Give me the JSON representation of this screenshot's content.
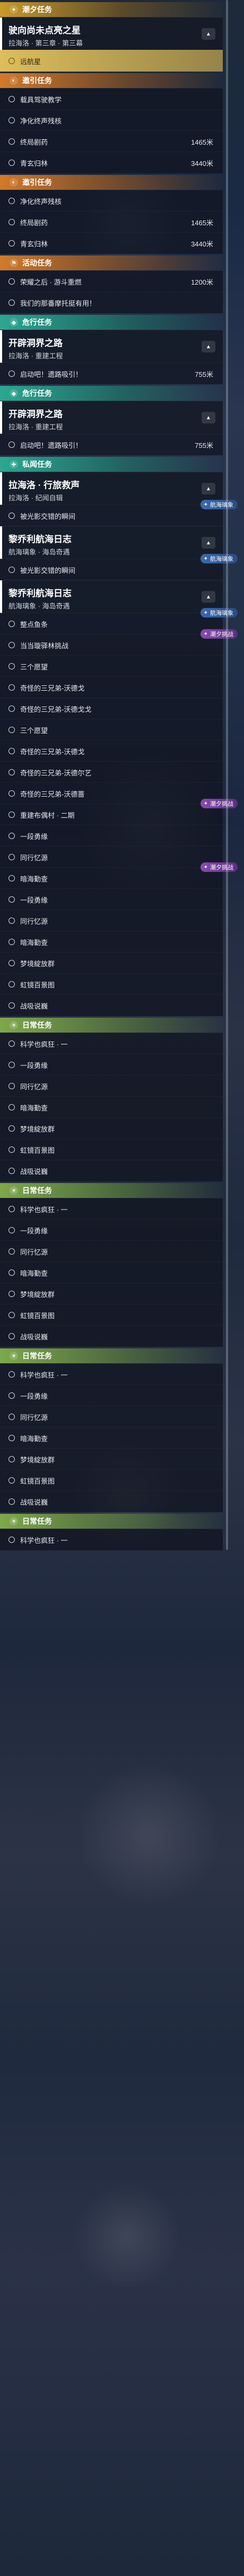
{
  "sections": [
    {
      "type": "cat",
      "color": "yellow",
      "icon": "plus-icon",
      "icon_glyph": "✦",
      "label": "潮夕任务"
    },
    {
      "type": "head",
      "title": "驶向尚未点亮之星",
      "subtitle": "拉海洛 · 第三章 · 第三幕"
    },
    {
      "type": "row",
      "selected": true,
      "text": "远航星"
    },
    {
      "type": "cat",
      "color": "orange",
      "icon": "compass-icon",
      "icon_glyph": "◐",
      "label": "邀引任务"
    },
    {
      "type": "row",
      "text": "载具驾驶教学"
    },
    {
      "type": "row",
      "text": "净化终声残核"
    },
    {
      "type": "row",
      "text": "终局剧药",
      "distance": "1465米"
    },
    {
      "type": "row",
      "text": "青玄归林",
      "distance": "3440米"
    },
    {
      "type": "cat",
      "color": "orange",
      "icon": "compass-icon",
      "icon_glyph": "◐",
      "label": "邀引任务"
    },
    {
      "type": "row",
      "text": "净化终声残核"
    },
    {
      "type": "row",
      "text": "终局剧药",
      "distance": "1465米"
    },
    {
      "type": "row",
      "text": "青玄归林",
      "distance": "3440米"
    },
    {
      "type": "cat",
      "color": "orange",
      "icon": "flag-icon",
      "icon_glyph": "⚑",
      "label": "活动任务"
    },
    {
      "type": "row",
      "text": "荣耀之后 · 游斗重燃",
      "distance": "1200米"
    },
    {
      "type": "row",
      "text": "我们的那番摩托挺有用！"
    },
    {
      "type": "cat",
      "color": "teal",
      "icon": "diamond-icon",
      "icon_glyph": "◆",
      "label": "危行任务"
    },
    {
      "type": "head",
      "title": "开辟洞界之路",
      "subtitle": "拉海洛 · 重建工程"
    },
    {
      "type": "row",
      "text": "启动吧！遗路吸引！",
      "distance": "755米"
    },
    {
      "type": "cat",
      "color": "teal",
      "icon": "diamond-icon",
      "icon_glyph": "◆",
      "label": "危行任务"
    },
    {
      "type": "head",
      "title": "开辟洞界之路",
      "subtitle": "拉海洛 · 重建工程"
    },
    {
      "type": "row",
      "text": "启动吧！遗路吸引！",
      "distance": "755米"
    },
    {
      "type": "cat",
      "color": "teal",
      "icon": "shield-icon",
      "icon_glyph": "✚",
      "label": "私闻任务"
    },
    {
      "type": "head",
      "title": "拉海洛 · 行旅救声",
      "subtitle": "拉海洛 · 纪闻自辑"
    },
    {
      "type": "row",
      "text": "被光影交错的瞬间",
      "badge": "航海璃象",
      "badge_style": "hh"
    },
    {
      "type": "head",
      "title": "黎乔利航海日志",
      "subtitle": "航海璃象 · 海岛奇遇"
    },
    {
      "type": "row",
      "text": "被光影交错的瞬间",
      "badge": "航海璃象",
      "badge_style": "hh"
    },
    {
      "type": "head",
      "title": "黎乔利航海日志",
      "subtitle": "航海璃象 · 海岛奇遇"
    },
    {
      "type": "row",
      "text": "整点鱼条",
      "badge": "航海璃象",
      "badge_style": "hh"
    },
    {
      "type": "row",
      "text": "当当璇驿林挑战",
      "badge": "潮夕挑战",
      "badge_style": "cx"
    },
    {
      "type": "row",
      "text": "三个愿望"
    },
    {
      "type": "row",
      "text": "奇怪的三兄弟-沃德戈"
    },
    {
      "type": "row",
      "text": "奇怪的三兄弟-沃德戈戈"
    },
    {
      "type": "row",
      "text": "三个愿望"
    },
    {
      "type": "row",
      "text": "奇怪的三兄弟-沃德戈"
    },
    {
      "type": "row",
      "text": "奇怪的三兄弟-沃德尔艺"
    },
    {
      "type": "row",
      "text": "奇怪的三兄弟-沃德蔷"
    },
    {
      "type": "row",
      "text": "重建布偶村 · 二期",
      "badge": "潮夕挑战",
      "badge_style": "cx"
    },
    {
      "type": "row",
      "text": "一段勇缘"
    },
    {
      "type": "row",
      "text": "同行忆源"
    },
    {
      "type": "row",
      "text": "暗海勤查",
      "badge": "潮夕挑战",
      "badge_style": "cx"
    },
    {
      "type": "row",
      "text": "一段勇缘"
    },
    {
      "type": "row",
      "text": "同行忆源"
    },
    {
      "type": "row",
      "text": "暗海勤查"
    },
    {
      "type": "row",
      "text": "梦境綻放群"
    },
    {
      "type": "row",
      "text": "虹镜百景图"
    },
    {
      "type": "row",
      "text": "战吸说巍"
    },
    {
      "type": "cat",
      "color": "green",
      "icon": "sun-icon",
      "icon_glyph": "☀",
      "label": "日常任务"
    },
    {
      "type": "row",
      "text": "科学也疯狂 · 一"
    },
    {
      "type": "row",
      "text": "一段勇缘"
    },
    {
      "type": "row",
      "text": "同行忆源"
    },
    {
      "type": "row",
      "text": "暗海勤查"
    },
    {
      "type": "row",
      "text": "梦境綻放群"
    },
    {
      "type": "row",
      "text": "虹镜百景图"
    },
    {
      "type": "row",
      "text": "战吸说巍"
    },
    {
      "type": "cat",
      "color": "green",
      "icon": "sun-icon",
      "icon_glyph": "☀",
      "label": "日常任务"
    },
    {
      "type": "row",
      "text": "科学也疯狂 · 一"
    },
    {
      "type": "row",
      "text": "一段勇缘"
    },
    {
      "type": "row",
      "text": "同行忆源"
    },
    {
      "type": "row",
      "text": "暗海勤查"
    },
    {
      "type": "row",
      "text": "梦境綻放群"
    },
    {
      "type": "row",
      "text": "虹镜百景图"
    },
    {
      "type": "row",
      "text": "战吸说巍"
    },
    {
      "type": "cat",
      "color": "green",
      "icon": "sun-icon",
      "icon_glyph": "☀",
      "label": "日常任务"
    },
    {
      "type": "row",
      "text": "科学也疯狂 · 一"
    },
    {
      "type": "row",
      "text": "一段勇缘"
    },
    {
      "type": "row",
      "text": "同行忆源"
    },
    {
      "type": "row",
      "text": "暗海勤查"
    },
    {
      "type": "row",
      "text": "梦境綻放群"
    },
    {
      "type": "row",
      "text": "虹镜百景图"
    },
    {
      "type": "row",
      "text": "战吸说巍"
    },
    {
      "type": "cat",
      "color": "green",
      "icon": "sun-icon",
      "icon_glyph": "☀",
      "label": "日常任务"
    },
    {
      "type": "row",
      "text": "科学也疯狂 · 一"
    }
  ]
}
